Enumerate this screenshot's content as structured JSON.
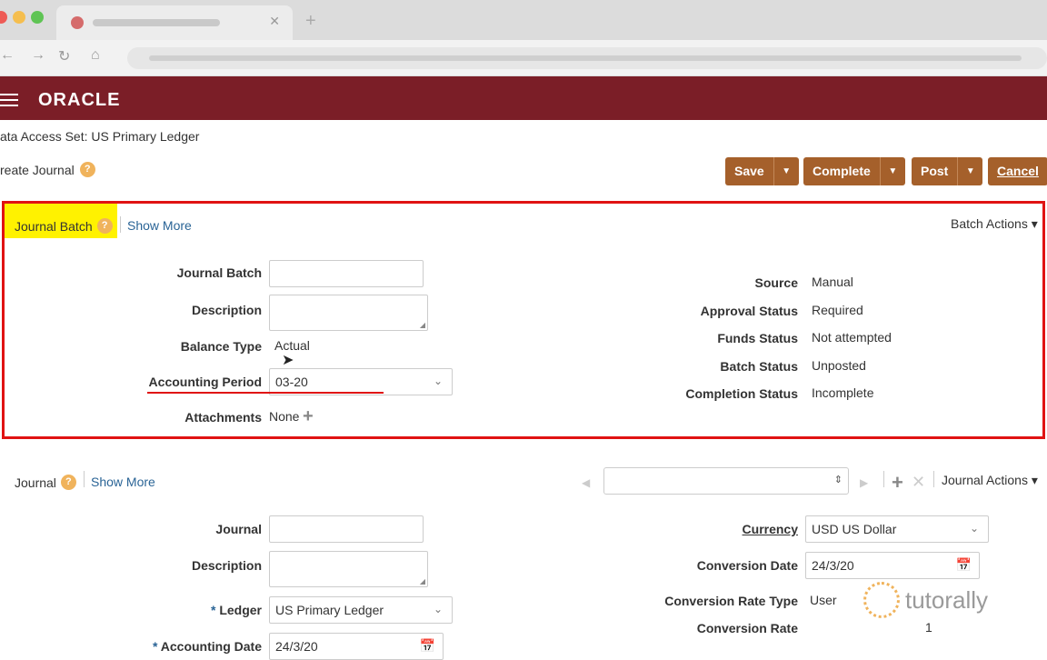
{
  "header": {
    "logo": "ORACLE",
    "data_access_set": "ata Access Set: US Primary Ledger",
    "page_title": "reate Journal",
    "help": "?"
  },
  "toolbar": {
    "save": "Save",
    "complete": "Complete",
    "post": "Post",
    "cancel": "Cancel",
    "dd": "▼"
  },
  "batch": {
    "title": "Journal Batch",
    "show_more": "Show More",
    "actions": "Batch Actions ▾",
    "labels": {
      "journal_batch": "Journal Batch",
      "description": "Description",
      "balance_type": "Balance Type",
      "accounting_period": "Accounting Period",
      "attachments": "Attachments"
    },
    "values": {
      "balance_type": "Actual",
      "accounting_period": "03-20",
      "attachments": "None"
    },
    "right_labels": {
      "source": "Source",
      "approval_status": "Approval Status",
      "funds_status": "Funds Status",
      "batch_status": "Batch Status",
      "completion_status": "Completion Status"
    },
    "right_values": {
      "source": "Manual",
      "approval_status": "Required",
      "funds_status": "Not attempted",
      "batch_status": "Unposted",
      "completion_status": "Incomplete"
    }
  },
  "journal": {
    "title": "Journal",
    "show_more": "Show More",
    "actions": "Journal Actions ▾",
    "labels": {
      "journal": "Journal",
      "description": "Description",
      "ledger": "Ledger",
      "accounting_date": "Accounting Date",
      "currency": "Currency",
      "conversion_date": "Conversion Date",
      "conversion_rate_type": "Conversion Rate Type",
      "conversion_rate": "Conversion Rate"
    },
    "values": {
      "ledger": "US Primary Ledger",
      "accounting_date": "24/3/20",
      "currency": "USD US Dollar",
      "conversion_date": "24/3/20",
      "conversion_rate_type": "User",
      "conversion_rate": "1"
    }
  },
  "watermark": "tutorally"
}
